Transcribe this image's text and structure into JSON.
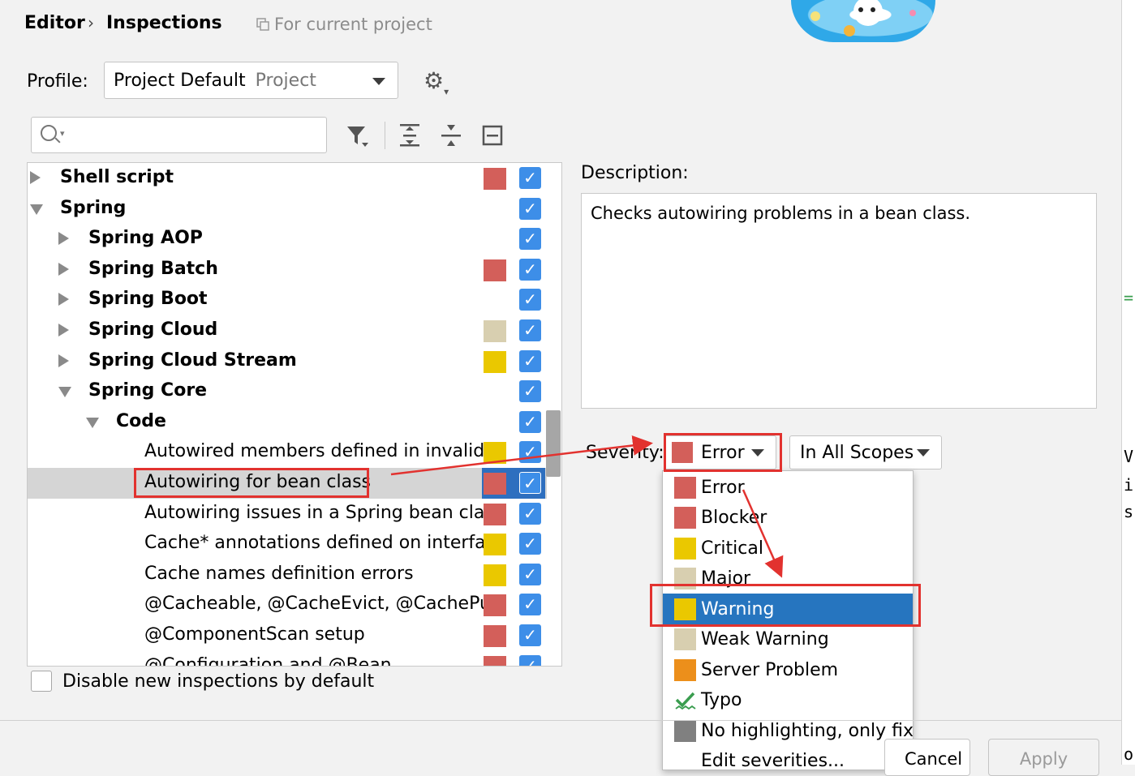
{
  "header": {
    "breadcrumb_parent": "Editor",
    "breadcrumb_sep": "›",
    "breadcrumb_current": "Inspections",
    "scope_note": "For current project"
  },
  "profile": {
    "label": "Profile:",
    "value": "Project Default",
    "value_sub": "Project"
  },
  "search": {
    "placeholder": ""
  },
  "tree": {
    "rows": [
      {
        "label": "Shell script",
        "indent": 0,
        "expander": "collapsed",
        "bold": true,
        "severity_color": "#d35f5a",
        "checked": true
      },
      {
        "label": "Spring",
        "indent": 0,
        "expander": "expanded",
        "bold": true,
        "severity_color": "",
        "checked": true
      },
      {
        "label": "Spring AOP",
        "indent": 1,
        "expander": "collapsed",
        "bold": true,
        "severity_color": "",
        "checked": true
      },
      {
        "label": "Spring Batch",
        "indent": 1,
        "expander": "collapsed",
        "bold": true,
        "severity_color": "#d35f5a",
        "checked": true
      },
      {
        "label": "Spring Boot",
        "indent": 1,
        "expander": "collapsed",
        "bold": true,
        "severity_color": "",
        "checked": true
      },
      {
        "label": "Spring Cloud",
        "indent": 1,
        "expander": "collapsed",
        "bold": true,
        "severity_color": "#d8cfb0",
        "checked": true
      },
      {
        "label": "Spring Cloud Stream",
        "indent": 1,
        "expander": "collapsed",
        "bold": true,
        "severity_color": "#eac800",
        "checked": true
      },
      {
        "label": "Spring Core",
        "indent": 1,
        "expander": "expanded",
        "bold": true,
        "severity_color": "",
        "checked": true
      },
      {
        "label": "Code",
        "indent": 2,
        "expander": "expanded",
        "bold": true,
        "severity_color": "",
        "checked": true
      },
      {
        "label": "Autowired members defined in invalid Sp",
        "indent": 3,
        "expander": "",
        "bold": false,
        "severity_color": "#eac800",
        "checked": true
      },
      {
        "label": "Autowiring for bean class",
        "indent": 3,
        "expander": "",
        "bold": false,
        "severity_color": "#d35f5a",
        "checked": true,
        "selected": true
      },
      {
        "label": "Autowiring issues in a Spring bean class c",
        "indent": 3,
        "expander": "",
        "bold": false,
        "severity_color": "#d35f5a",
        "checked": true
      },
      {
        "label": "Cache* annotations defined on interfaces",
        "indent": 3,
        "expander": "",
        "bold": false,
        "severity_color": "#eac800",
        "checked": true
      },
      {
        "label": "Cache names definition errors",
        "indent": 3,
        "expander": "",
        "bold": false,
        "severity_color": "#eac800",
        "checked": true
      },
      {
        "label": "@Cacheable, @CacheEvict, @CachePut, (",
        "indent": 3,
        "expander": "",
        "bold": false,
        "severity_color": "#d35f5a",
        "checked": true
      },
      {
        "label": "@ComponentScan setup",
        "indent": 3,
        "expander": "",
        "bold": false,
        "severity_color": "#d35f5a",
        "checked": true
      },
      {
        "label": "@Configuration and @Bean",
        "indent": 3,
        "expander": "",
        "bold": false,
        "severity_color": "#d35f5a",
        "checked": true
      }
    ]
  },
  "disable_new": {
    "label": "Disable new inspections by default"
  },
  "description": {
    "label": "Description:",
    "text": "Checks autowiring problems in a bean class."
  },
  "severity": {
    "label": "Severity:",
    "value": "Error",
    "value_color": "#d35f5a",
    "scope": "In All Scopes"
  },
  "severity_options": [
    {
      "label": "Error",
      "color": "#d35f5a",
      "icon": "square"
    },
    {
      "label": "Blocker",
      "color": "#d35f5a",
      "icon": "square"
    },
    {
      "label": "Critical",
      "color": "#eac800",
      "icon": "square"
    },
    {
      "label": "Major",
      "color": "#d8cfb0",
      "icon": "square"
    },
    {
      "label": "Warning",
      "color": "#eac800",
      "icon": "square",
      "highlighted": true
    },
    {
      "label": "Weak Warning",
      "color": "#d8cfb0",
      "icon": "square"
    },
    {
      "label": "Server Problem",
      "color": "#ec8f1b",
      "icon": "square"
    },
    {
      "label": "Typo",
      "color": "#3a9d4f",
      "icon": "typo-check-icon"
    },
    {
      "label": "No highlighting, only fix",
      "color": "#808080",
      "icon": "square"
    },
    {
      "label": "Edit severities...",
      "color": "",
      "icon": ""
    }
  ],
  "buttons": {
    "cancel": "Cancel",
    "apply": "Apply"
  },
  "background_edge": {
    "chars": [
      "=",
      "V",
      "i",
      "s",
      "o"
    ]
  }
}
